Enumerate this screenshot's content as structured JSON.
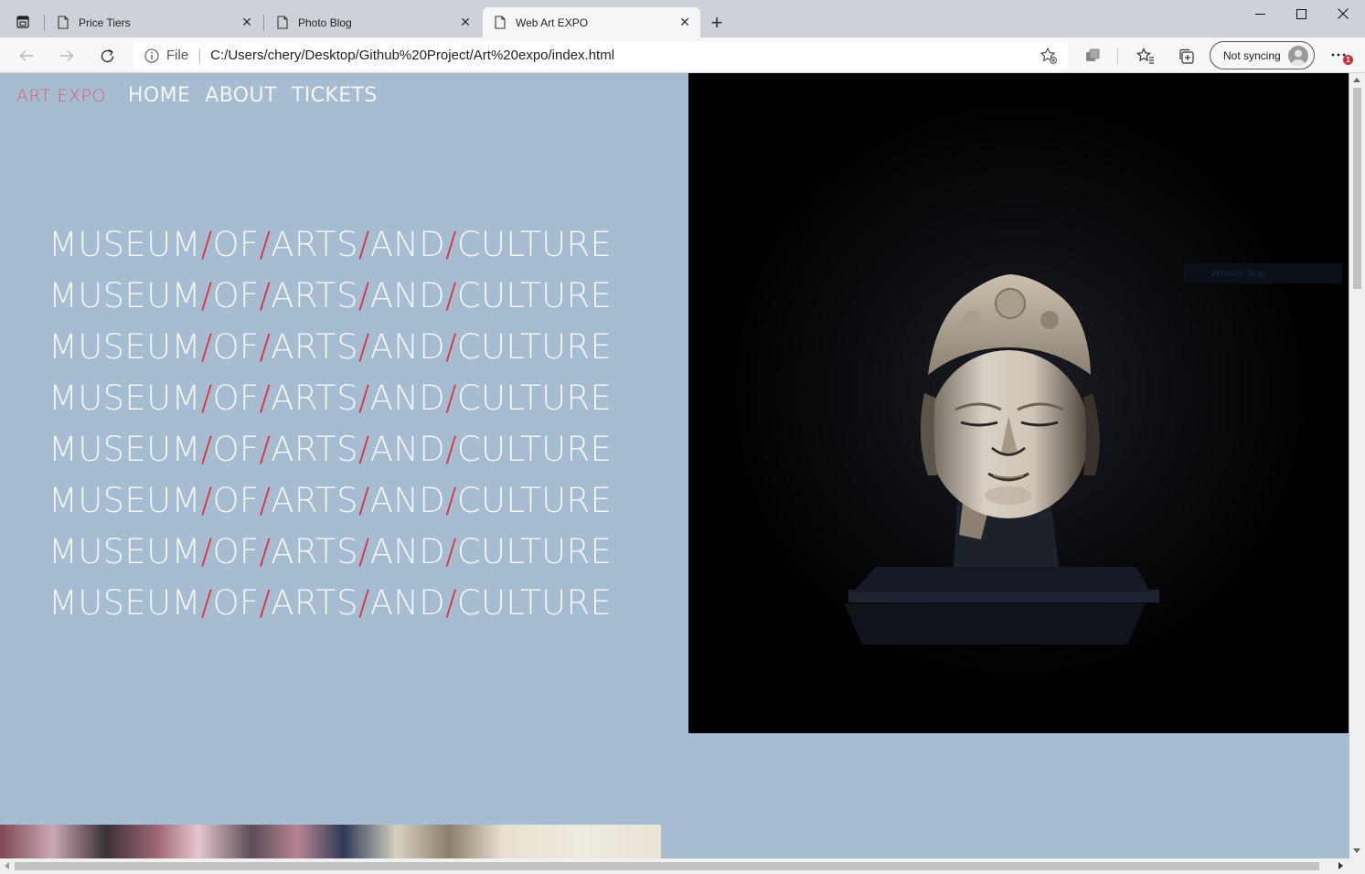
{
  "tabs": [
    {
      "title": "Price Tiers"
    },
    {
      "title": "Photo Blog"
    },
    {
      "title": "Web Art EXPO"
    }
  ],
  "address_bar": {
    "scheme_label": "File",
    "url": "C:/Users/chery/Desktop/Github%20Project/Art%20expo/index.html"
  },
  "profile": {
    "sync_label": "Not syncing"
  },
  "notification_count": "1",
  "site": {
    "brand": "ART EXPO",
    "nav": [
      "HOME",
      "ABOUT",
      "TICKETS"
    ],
    "hero_words": [
      "MUSEUM",
      "OF",
      "ARTS",
      "AND",
      "CULTURE"
    ]
  },
  "overlay": {
    "window_snip_label": "Window Snip"
  },
  "colors": {
    "page_bg": "#a5bcd1",
    "brand_accent": "#e0606c",
    "slash_accent": "#e03040",
    "text_light": "#f3f5f7"
  }
}
